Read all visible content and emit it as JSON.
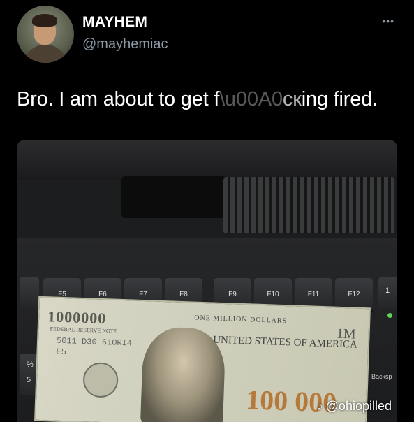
{
  "tweet": {
    "display_name": "MAYHEM",
    "handle": "@mayhemiac",
    "more_menu": "•••",
    "text": "Bro. I am about to get f  c •ing fired."
  },
  "media": {
    "function_keys": [
      "F5",
      "F6",
      "F7",
      "F8",
      "F9",
      "F10",
      "F11",
      "F12"
    ],
    "side_key_right": "1",
    "side_key_left_top": "%",
    "side_key_left_bottom": "5",
    "backspace_label": "Backsp",
    "bill": {
      "denomination": "1000000",
      "federal_note": "FEDERAL RESERVE NOTE",
      "serial": "5011 D30 61ORI4",
      "serial_suffix": "E5",
      "one_million": "ONE MILLION DOLLARS",
      "country": "UNITED STATES OF AMERICA",
      "corner": "1M",
      "amount": "100 000"
    },
    "watermark": "@ohiopilled",
    "watermark_icon": "tiktok-icon"
  }
}
